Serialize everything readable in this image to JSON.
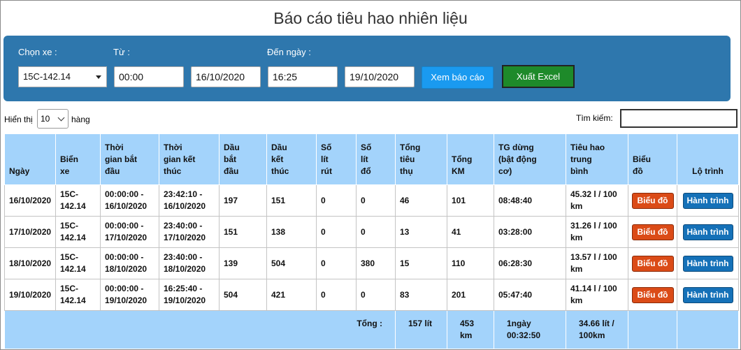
{
  "page": {
    "title": "Báo cáo tiêu hao nhiên liệu"
  },
  "filters": {
    "vehicle_label": "Chọn xe :",
    "vehicle_value": "15C-142.14",
    "from_label": "Từ :",
    "from_time": "00:00",
    "from_date": "16/10/2020",
    "to_label": "Đến ngày :",
    "to_time": "16:25",
    "to_date": "19/10/2020",
    "view_button": "Xem báo cáo",
    "excel_button": "Xuất Excel"
  },
  "table_controls": {
    "show_prefix": "Hiển thị",
    "show_value": "10",
    "show_suffix": "hàng",
    "search_label": "Tìm kiếm:"
  },
  "columns": [
    [
      "Ngày"
    ],
    [
      "Biển",
      "xe"
    ],
    [
      "Thời",
      "gian bắt",
      "đầu"
    ],
    [
      "Thời",
      "gian kết",
      "thúc"
    ],
    [
      "Dầu",
      "bắt",
      "đầu"
    ],
    [
      "Dầu",
      "kết",
      "thúc"
    ],
    [
      "Số",
      "lít",
      "rút"
    ],
    [
      "Số",
      "lít",
      "đổ"
    ],
    [
      "Tổng",
      "tiêu",
      "thụ"
    ],
    [
      "Tổng",
      "KM"
    ],
    [
      "TG dừng",
      "(bật động",
      "cơ)"
    ],
    [
      "Tiêu hao",
      "trung",
      "bình"
    ],
    [
      "Biểu",
      "đồ"
    ],
    [
      "Lộ trình"
    ]
  ],
  "rows": [
    {
      "date": "16/10/2020",
      "plate": [
        "15C-",
        "142.14"
      ],
      "start": [
        "00:00:00 -",
        "16/10/2020"
      ],
      "end": [
        "23:42:10 -",
        "16/10/2020"
      ],
      "fuel_start": "197",
      "fuel_end": "151",
      "withdrawn": "0",
      "refilled": "0",
      "consumed": "46",
      "km": "101",
      "stop_time": "08:48:40",
      "avg": [
        "45.32 l / 100",
        "km"
      ]
    },
    {
      "date": "17/10/2020",
      "plate": [
        "15C-",
        "142.14"
      ],
      "start": [
        "00:00:00 -",
        "17/10/2020"
      ],
      "end": [
        "23:40:00 -",
        "17/10/2020"
      ],
      "fuel_start": "151",
      "fuel_end": "138",
      "withdrawn": "0",
      "refilled": "0",
      "consumed": "13",
      "km": "41",
      "stop_time": "03:28:00",
      "avg": [
        "31.26 l / 100",
        "km"
      ]
    },
    {
      "date": "18/10/2020",
      "plate": [
        "15C-",
        "142.14"
      ],
      "start": [
        "00:00:00 -",
        "18/10/2020"
      ],
      "end": [
        "23:40:00 -",
        "18/10/2020"
      ],
      "fuel_start": "139",
      "fuel_end": "504",
      "withdrawn": "0",
      "refilled": "380",
      "consumed": "15",
      "km": "110",
      "stop_time": "06:28:30",
      "avg": [
        "13.57 l / 100",
        "km"
      ]
    },
    {
      "date": "19/10/2020",
      "plate": [
        "15C-",
        "142.14"
      ],
      "start": [
        "00:00:00 -",
        "19/10/2020"
      ],
      "end": [
        "16:25:40 -",
        "19/10/2020"
      ],
      "fuel_start": "504",
      "fuel_end": "421",
      "withdrawn": "0",
      "refilled": "0",
      "consumed": "83",
      "km": "201",
      "stop_time": "05:47:40",
      "avg": [
        "41.14 l / 100",
        "km"
      ]
    }
  ],
  "row_buttons": {
    "chart": "Biểu đồ",
    "route": "Hành trình"
  },
  "totals": {
    "label": "Tổng :",
    "consumed": "157 lít",
    "km": [
      "453",
      "km"
    ],
    "stop_time": [
      "1ngày",
      "00:32:50"
    ],
    "avg": [
      "34.66 lít /",
      "100km"
    ]
  },
  "colors": {
    "panel_bg": "#2e77ad",
    "view_button": "#1a9af0",
    "excel_button": "#1e8a2a",
    "table_header": "#a3d3fb",
    "chart_button": "#db4b17",
    "route_button": "#1571b8"
  }
}
